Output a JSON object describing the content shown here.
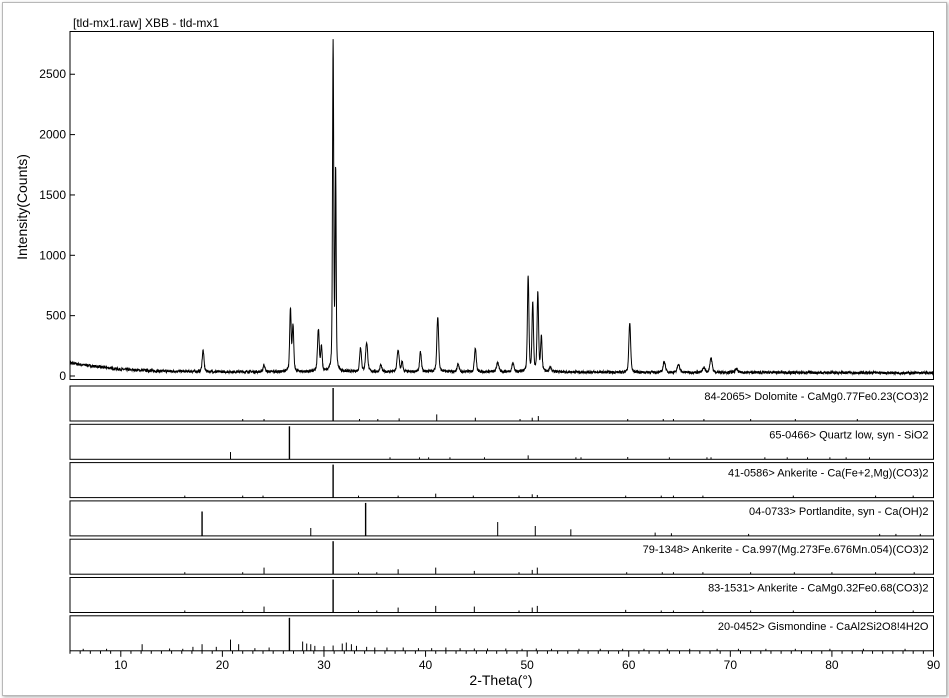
{
  "chart_data": {
    "type": "line",
    "title": "[tld-mx1.raw] XBB - tld-mx1",
    "xlabel": "2-Theta(°)",
    "ylabel": "Intensity(Counts)",
    "xlim": [
      5,
      90
    ],
    "ylim": [
      0,
      2850
    ],
    "xticks": [
      10,
      20,
      30,
      40,
      50,
      60,
      70,
      80,
      90
    ],
    "yticks": [
      0,
      500,
      1000,
      1500,
      2000,
      2500
    ],
    "grid": false,
    "colors": {
      "line": "#000000",
      "axis": "#000000",
      "background": "#ffffff"
    },
    "pattern": {
      "name": "tld-mx1",
      "baseline": [
        [
          5,
          110
        ],
        [
          6,
          95
        ],
        [
          8,
          75
        ],
        [
          10,
          55
        ],
        [
          14,
          40
        ],
        [
          20,
          35
        ],
        [
          30,
          35
        ],
        [
          40,
          35
        ],
        [
          50,
          35
        ],
        [
          60,
          30
        ],
        [
          70,
          30
        ],
        [
          80,
          28
        ],
        [
          90,
          25
        ]
      ],
      "peaks": [
        [
          18.1,
          175,
          0.12
        ],
        [
          24.1,
          60,
          0.12
        ],
        [
          26.7,
          520,
          0.1
        ],
        [
          26.95,
          380,
          0.1
        ],
        [
          29.45,
          350,
          0.12
        ],
        [
          29.75,
          200,
          0.1
        ],
        [
          30.9,
          2720,
          0.08
        ],
        [
          31.15,
          1650,
          0.07
        ],
        [
          33.6,
          200,
          0.12
        ],
        [
          34.2,
          240,
          0.14
        ],
        [
          35.6,
          55,
          0.12
        ],
        [
          37.3,
          180,
          0.14
        ],
        [
          37.7,
          80,
          0.1
        ],
        [
          39.5,
          160,
          0.12
        ],
        [
          41.2,
          460,
          0.12
        ],
        [
          43.2,
          70,
          0.12
        ],
        [
          44.9,
          200,
          0.12
        ],
        [
          47.1,
          80,
          0.14
        ],
        [
          48.6,
          70,
          0.14
        ],
        [
          50.1,
          790,
          0.1
        ],
        [
          50.55,
          560,
          0.1
        ],
        [
          51.05,
          650,
          0.1
        ],
        [
          51.4,
          280,
          0.1
        ],
        [
          52.3,
          40,
          0.12
        ],
        [
          60.1,
          410,
          0.12
        ],
        [
          63.5,
          90,
          0.15
        ],
        [
          64.9,
          70,
          0.15
        ],
        [
          67.4,
          40,
          0.15
        ],
        [
          68.1,
          120,
          0.15
        ],
        [
          70.6,
          30,
          0.15
        ]
      ]
    },
    "references": [
      {
        "label": "84-2065> Dolomite - CaMg0.77Fe0.23(CO3)2",
        "lines": [
          [
            30.9,
            1
          ],
          [
            41.1,
            0.2
          ],
          [
            44.9,
            0.1
          ],
          [
            50.5,
            0.1
          ],
          [
            51.1,
            0.15
          ],
          [
            37.4,
            0.08
          ],
          [
            33.5,
            0.05
          ],
          [
            22.0,
            0.03
          ],
          [
            24.1,
            0.06
          ],
          [
            35.3,
            0.03
          ],
          [
            49.3,
            0.03
          ],
          [
            59.9,
            0.05
          ],
          [
            63.4,
            0.03
          ],
          [
            64.4,
            0.03
          ],
          [
            67.4,
            0.04
          ],
          [
            72.0,
            0.02
          ],
          [
            76.4,
            0.02
          ],
          [
            82.5,
            0.02
          ]
        ]
      },
      {
        "label": "65-0466> Quartz low, syn - SiO2",
        "lines": [
          [
            26.6,
            1
          ],
          [
            20.8,
            0.22
          ],
          [
            36.5,
            0.06
          ],
          [
            39.4,
            0.05
          ],
          [
            40.3,
            0.03
          ],
          [
            42.4,
            0.05
          ],
          [
            45.8,
            0.04
          ],
          [
            50.1,
            0.12
          ],
          [
            54.8,
            0.03
          ],
          [
            55.3,
            0.02
          ],
          [
            59.9,
            0.07
          ],
          [
            64.0,
            0.02
          ],
          [
            67.7,
            0.04
          ],
          [
            68.1,
            0.06
          ],
          [
            73.4,
            0.02
          ],
          [
            75.6,
            0.02
          ],
          [
            77.6,
            0.02
          ],
          [
            79.8,
            0.02
          ],
          [
            81.4,
            0.02
          ],
          [
            83.7,
            0.02
          ]
        ]
      },
      {
        "label": "41-0586> Ankerite - Ca(Fe+2,Mg)(CO3)2",
        "lines": [
          [
            30.9,
            1
          ],
          [
            41.0,
            0.12
          ],
          [
            44.7,
            0.06
          ],
          [
            50.5,
            0.1
          ],
          [
            51.0,
            0.08
          ],
          [
            37.3,
            0.05
          ],
          [
            33.4,
            0.04
          ],
          [
            22.0,
            0.03
          ],
          [
            24.0,
            0.04
          ],
          [
            16.3,
            0.02
          ],
          [
            49.2,
            0.03
          ],
          [
            59.7,
            0.04
          ],
          [
            63.2,
            0.03
          ],
          [
            64.4,
            0.02
          ],
          [
            67.3,
            0.03
          ],
          [
            76.2,
            0.02
          ],
          [
            84.3,
            0.02
          ],
          [
            88.0,
            0.02
          ]
        ]
      },
      {
        "label": "04-0733> Portlandite, syn - Ca(OH)2",
        "lines": [
          [
            18.0,
            0.74
          ],
          [
            28.7,
            0.24
          ],
          [
            34.1,
            1
          ],
          [
            47.1,
            0.42
          ],
          [
            50.8,
            0.3
          ],
          [
            54.3,
            0.2
          ],
          [
            62.6,
            0.1
          ],
          [
            64.2,
            0.08
          ],
          [
            71.8,
            0.06
          ],
          [
            84.7,
            0.06
          ],
          [
            86.3,
            0.04
          ],
          [
            88.7,
            0.04
          ]
        ]
      },
      {
        "label": "79-1348> Ankerite - Ca.997(Mg.273Fe.676Mn.054)(CO3)2",
        "lines": [
          [
            30.9,
            1
          ],
          [
            41.0,
            0.2
          ],
          [
            44.8,
            0.1
          ],
          [
            50.5,
            0.13
          ],
          [
            51.0,
            0.2
          ],
          [
            37.3,
            0.15
          ],
          [
            24.1,
            0.2
          ],
          [
            33.4,
            0.05
          ],
          [
            35.2,
            0.05
          ],
          [
            22.0,
            0.05
          ],
          [
            16.3,
            0.04
          ],
          [
            49.2,
            0.05
          ],
          [
            59.8,
            0.06
          ],
          [
            63.3,
            0.05
          ],
          [
            64.4,
            0.04
          ],
          [
            67.3,
            0.05
          ],
          [
            72.0,
            0.03
          ],
          [
            76.3,
            0.03
          ],
          [
            80.0,
            0.03
          ],
          [
            84.3,
            0.03
          ],
          [
            88.1,
            0.03
          ]
        ]
      },
      {
        "label": "83-1531> Ankerite - CaMg0.32Fe0.68(CO3)2",
        "lines": [
          [
            30.9,
            1
          ],
          [
            41.0,
            0.2
          ],
          [
            44.8,
            0.18
          ],
          [
            50.5,
            0.15
          ],
          [
            51.0,
            0.2
          ],
          [
            37.3,
            0.15
          ],
          [
            24.1,
            0.18
          ],
          [
            33.4,
            0.05
          ],
          [
            35.2,
            0.05
          ],
          [
            22.0,
            0.05
          ],
          [
            16.3,
            0.06
          ],
          [
            49.2,
            0.05
          ],
          [
            59.7,
            0.08
          ],
          [
            63.2,
            0.05
          ],
          [
            64.4,
            0.05
          ],
          [
            67.3,
            0.06
          ],
          [
            72.0,
            0.04
          ],
          [
            76.2,
            0.04
          ],
          [
            84.3,
            0.04
          ],
          [
            88.0,
            0.04
          ]
        ]
      },
      {
        "label": "20-0452> Gismondine - CaAl2Si2O8!4H2O",
        "lines": [
          [
            26.6,
            1
          ],
          [
            20.8,
            0.34
          ],
          [
            21.6,
            0.2
          ],
          [
            12.1,
            0.2
          ],
          [
            17.1,
            0.12
          ],
          [
            18.0,
            0.2
          ],
          [
            19.4,
            0.12
          ],
          [
            27.9,
            0.28
          ],
          [
            28.3,
            0.22
          ],
          [
            28.7,
            0.2
          ],
          [
            29.1,
            0.15
          ],
          [
            30.0,
            0.14
          ],
          [
            30.9,
            0.16
          ],
          [
            31.8,
            0.22
          ],
          [
            32.2,
            0.25
          ],
          [
            32.7,
            0.2
          ],
          [
            33.2,
            0.15
          ],
          [
            34.2,
            0.12
          ],
          [
            35.0,
            0.1
          ],
          [
            36.2,
            0.1
          ],
          [
            37.8,
            0.1
          ],
          [
            39.3,
            0.08
          ],
          [
            40.6,
            0.08
          ],
          [
            42.0,
            0.1
          ],
          [
            43.4,
            0.08
          ],
          [
            44.8,
            0.07
          ],
          [
            46.1,
            0.07
          ],
          [
            47.9,
            0.07
          ],
          [
            49.5,
            0.06
          ],
          [
            50.9,
            0.07
          ],
          [
            52.4,
            0.06
          ],
          [
            55.1,
            0.05
          ],
          [
            57.2,
            0.05
          ],
          [
            59.4,
            0.05
          ],
          [
            61.5,
            0.05
          ],
          [
            63.8,
            0.04
          ],
          [
            66.0,
            0.04
          ],
          [
            68.7,
            0.04
          ],
          [
            70.8,
            0.03
          ],
          [
            73.5,
            0.03
          ],
          [
            76.4,
            0.03
          ],
          [
            79.8,
            0.03
          ],
          [
            83.1,
            0.03
          ],
          [
            87.2,
            0.03
          ],
          [
            6.3,
            0.04
          ],
          [
            8.6,
            0.06
          ],
          [
            14.8,
            0.07
          ],
          [
            16.1,
            0.05
          ],
          [
            23.2,
            0.08
          ],
          [
            24.6,
            0.1
          ]
        ]
      }
    ]
  }
}
